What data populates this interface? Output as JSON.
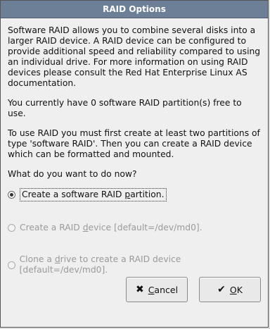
{
  "dialog": {
    "title": "RAID Options",
    "paragraph1": "Software RAID allows you to combine several disks into a larger RAID device.  A RAID device can be configured to provide additional speed and reliability compared to using an individual drive.  For more information on using RAID devices please consult the Red Hat Enterprise Linux AS documentation.",
    "paragraph2": "You currently have 0 software RAID partition(s) free to use.",
    "paragraph3": "To use RAID you must first create at least two partitions of type 'software RAID'.  Then you can create a RAID device which can be formatted and mounted.",
    "question": "What do you want to do now?",
    "options": [
      {
        "pre": "Create a software RAID ",
        "underline": "p",
        "post": "artition.",
        "selected": true,
        "enabled": true
      },
      {
        "pre": "Create a RAID ",
        "underline": "d",
        "post": "evice [default=/dev/md0].",
        "selected": false,
        "enabled": false
      },
      {
        "pre": "Clone a ",
        "underline": "d",
        "post": "rive to create a RAID device [default=/dev/md0].",
        "selected": false,
        "enabled": false
      }
    ],
    "buttons": {
      "cancel": {
        "underline": "C",
        "rest": "ancel",
        "icon": "cancel-x-icon"
      },
      "ok": {
        "underline": "O",
        "rest": "K",
        "icon": "ok-check-icon"
      }
    }
  },
  "colors": {
    "titlebar": "#6d7f97",
    "dialog_bg": "#efefef",
    "disabled_text": "#9a9a9a"
  }
}
